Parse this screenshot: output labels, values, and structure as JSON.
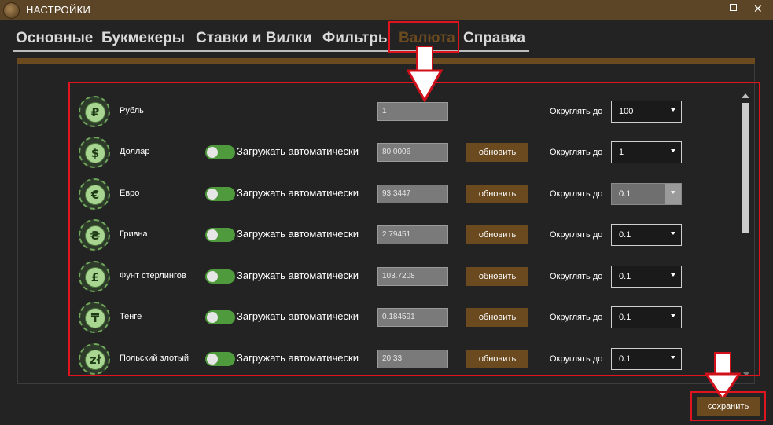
{
  "window": {
    "title": "НАСТРОЙКИ",
    "maximize_icon": "maximize-icon",
    "close_label": "✕"
  },
  "tabs": [
    {
      "label": "Основные",
      "active": false
    },
    {
      "label": "Букмекеры",
      "active": false
    },
    {
      "label": "Ставки и Вилки",
      "active": false
    },
    {
      "label": "Фильтры",
      "active": false
    },
    {
      "label": "Валюта",
      "active": true
    },
    {
      "label": "Справка",
      "active": false
    }
  ],
  "currencies": [
    {
      "name": "Рубль",
      "symbol": "₽",
      "has_auto": false,
      "rate": "1",
      "has_update": false,
      "round_to": "100"
    },
    {
      "name": "Доллар",
      "symbol": "$",
      "has_auto": true,
      "rate": "80.0006",
      "has_update": true,
      "round_to": "1"
    },
    {
      "name": "Евро",
      "symbol": "€",
      "has_auto": true,
      "rate": "93.3447",
      "has_update": true,
      "round_to": "0.1",
      "hover": true
    },
    {
      "name": "Гривна",
      "symbol": "₴",
      "has_auto": true,
      "rate": "2.79451",
      "has_update": true,
      "round_to": "0.1"
    },
    {
      "name": "Фунт стерлингов",
      "symbol": "£",
      "has_auto": true,
      "rate": "103.7208",
      "has_update": true,
      "round_to": "0.1"
    },
    {
      "name": "Тенге",
      "symbol": "₸",
      "has_auto": true,
      "rate": "0.184591",
      "has_update": true,
      "round_to": "0.1"
    },
    {
      "name": "Польский злотый",
      "symbol": "zł",
      "has_auto": true,
      "rate": "20.33",
      "has_update": true,
      "round_to": "0.1"
    }
  ],
  "labels": {
    "auto_load": "Загружать автоматически",
    "update_button": "обновить",
    "round_to": "Округлять до",
    "save_button": "сохранить"
  },
  "colors": {
    "accent_brown": "#6b4a1f",
    "titlebar": "#5c4526",
    "toggle_on": "#4e9a3c",
    "icon_green": "#a8d692",
    "annotation_red": "#e0141f"
  }
}
